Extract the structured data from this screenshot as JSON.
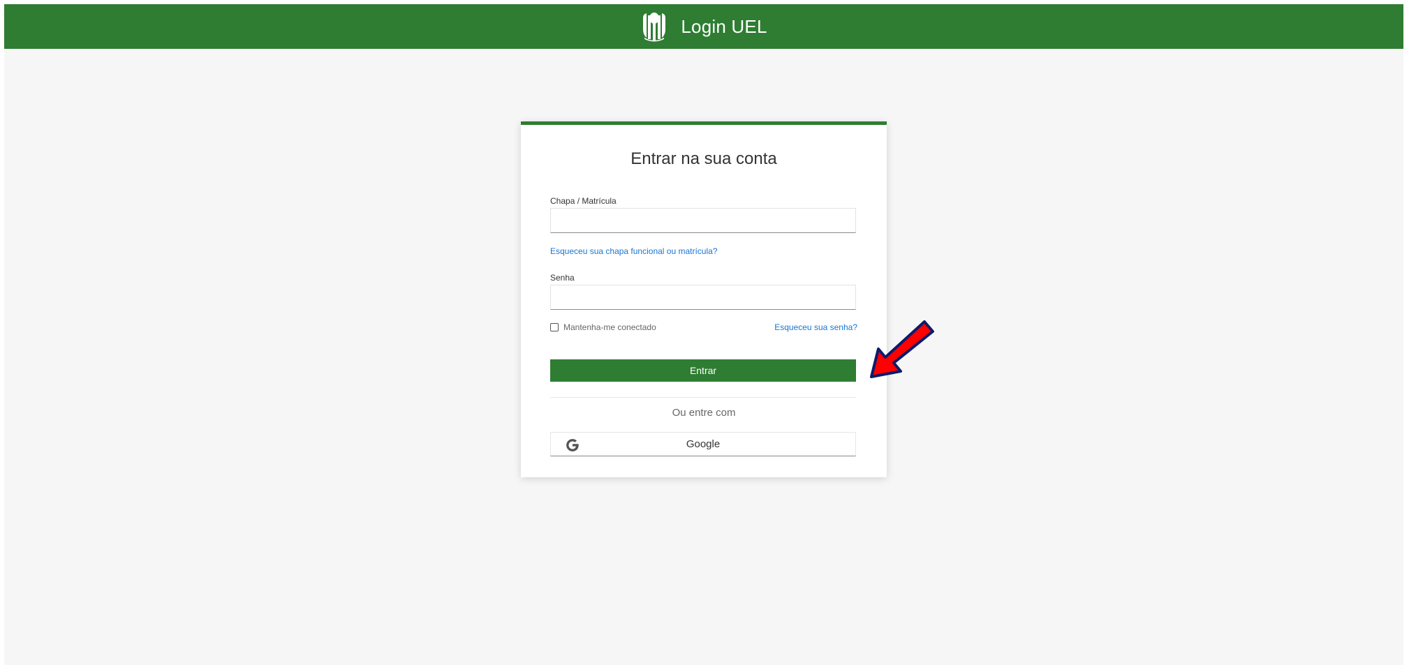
{
  "header": {
    "title": "Login UEL",
    "logo_icon": "uel-logo-icon",
    "background_color": "#2e7d32"
  },
  "login": {
    "heading": "Entrar na sua conta",
    "username_label": "Chapa / Matrícula",
    "username_value": "",
    "forgot_id_link": "Esqueceu sua chapa funcional ou matrícula?",
    "password_label": "Senha",
    "password_value": "",
    "remember_label": "Mantenha-me conectado",
    "remember_checked": false,
    "forgot_password_link": "Esqueceu sua senha?",
    "submit_label": "Entrar",
    "alt_login_text": "Ou entre com",
    "google_label": "Google",
    "accent_color": "#2e7d32",
    "link_color": "#1976d2"
  },
  "annotation": {
    "icon": "red-arrow-icon",
    "color": "#ff0000",
    "outline_color": "#0d1b6b"
  }
}
